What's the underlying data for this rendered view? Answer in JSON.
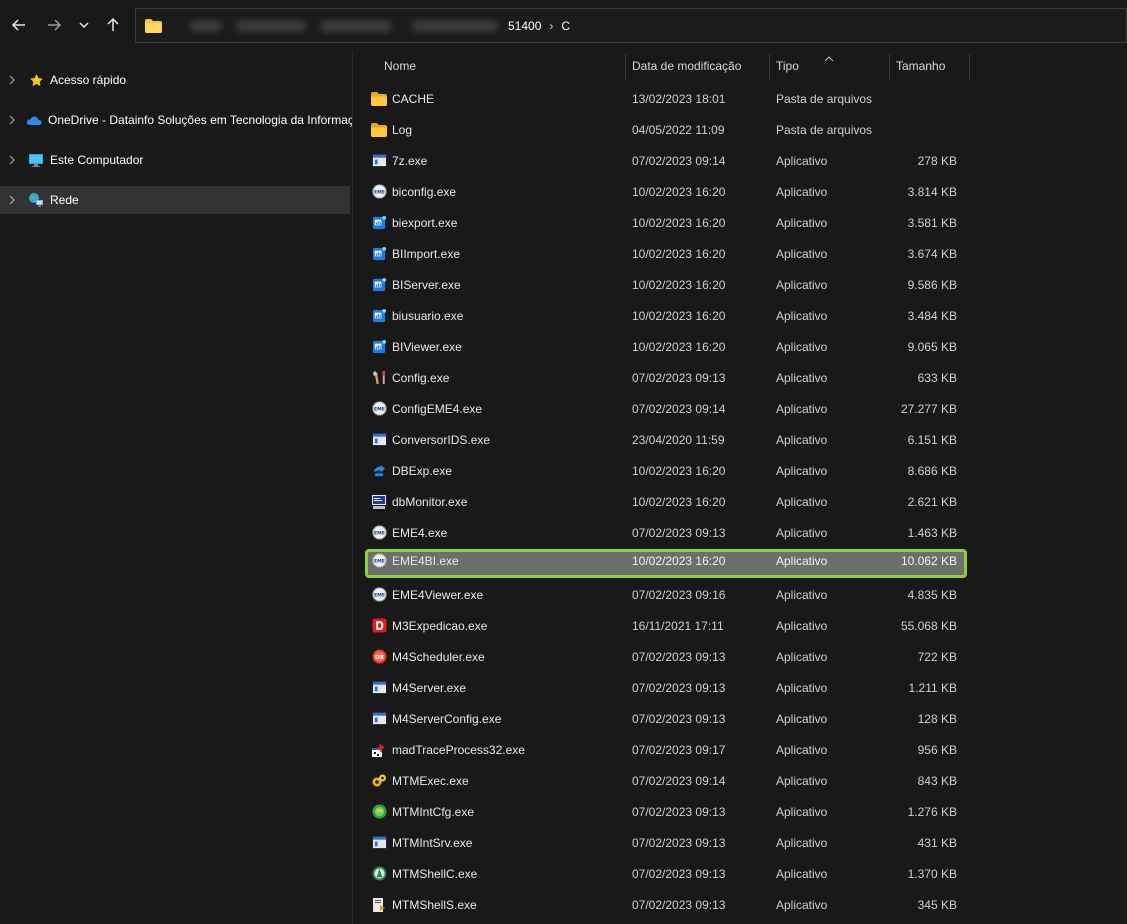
{
  "address": {
    "path_visible": [
      "51400",
      "C"
    ]
  },
  "sidebar": {
    "items": [
      {
        "label": "Acesso rápido",
        "icon": "star-icon"
      },
      {
        "label": "OneDrive - Datainfo Soluções em Tecnologia da Informação",
        "icon": "cloud-icon"
      },
      {
        "label": "Este Computador",
        "icon": "monitor-icon"
      },
      {
        "label": "Rede",
        "icon": "network-icon",
        "selected": true
      }
    ]
  },
  "columns": {
    "name": "Nome",
    "date": "Data de modificação",
    "type": "Tipo",
    "size": "Tamanho"
  },
  "files": [
    {
      "name": "CACHE",
      "date": "13/02/2023 18:01",
      "type": "Pasta de arquivos",
      "size": "",
      "icon": "folder-icon"
    },
    {
      "name": "Log",
      "date": "04/05/2022 11:09",
      "type": "Pasta de arquivos",
      "size": "",
      "icon": "folder-icon"
    },
    {
      "name": "7z.exe",
      "date": "07/02/2023 09:14",
      "type": "Aplicativo",
      "size": "278 KB",
      "icon": "window-app-icon"
    },
    {
      "name": "biconfig.exe",
      "date": "10/02/2023 16:20",
      "type": "Aplicativo",
      "size": "3.814 KB",
      "icon": "eme-icon"
    },
    {
      "name": "biexport.exe",
      "date": "10/02/2023 16:20",
      "type": "Aplicativo",
      "size": "3.581 KB",
      "icon": "bi-icon"
    },
    {
      "name": "BIImport.exe",
      "date": "10/02/2023 16:20",
      "type": "Aplicativo",
      "size": "3.674 KB",
      "icon": "bi-icon"
    },
    {
      "name": "BIServer.exe",
      "date": "10/02/2023 16:20",
      "type": "Aplicativo",
      "size": "9.586 KB",
      "icon": "bi-icon"
    },
    {
      "name": "biusuario.exe",
      "date": "10/02/2023 16:20",
      "type": "Aplicativo",
      "size": "3.484 KB",
      "icon": "bi-icon"
    },
    {
      "name": "BIViewer.exe",
      "date": "10/02/2023 16:20",
      "type": "Aplicativo",
      "size": "9.065 KB",
      "icon": "bi-icon"
    },
    {
      "name": "Config.exe",
      "date": "07/02/2023 09:13",
      "type": "Aplicativo",
      "size": "633 KB",
      "icon": "tools-icon"
    },
    {
      "name": "ConfigEME4.exe",
      "date": "07/02/2023 09:14",
      "type": "Aplicativo",
      "size": "27.277 KB",
      "icon": "eme-icon"
    },
    {
      "name": "ConversorIDS.exe",
      "date": "23/04/2020 11:59",
      "type": "Aplicativo",
      "size": "6.151 KB",
      "icon": "window-app-icon"
    },
    {
      "name": "DBExp.exe",
      "date": "10/02/2023 16:20",
      "type": "Aplicativo",
      "size": "8.686 KB",
      "icon": "dbexp-icon"
    },
    {
      "name": "dbMonitor.exe",
      "date": "10/02/2023 16:20",
      "type": "Aplicativo",
      "size": "2.621 KB",
      "icon": "monitor-app-icon"
    },
    {
      "name": "EME4.exe",
      "date": "07/02/2023 09:13",
      "type": "Aplicativo",
      "size": "1.463 KB",
      "icon": "eme-icon"
    },
    {
      "name": "EME4BI.exe",
      "date": "10/02/2023 16:20",
      "type": "Aplicativo",
      "size": "10.062 KB",
      "icon": "eme-icon",
      "selected": true
    },
    {
      "name": "EME4Viewer.exe",
      "date": "07/02/2023 09:16",
      "type": "Aplicativo",
      "size": "4.835 KB",
      "icon": "eme-icon"
    },
    {
      "name": "M3Expedicao.exe",
      "date": "16/11/2021 17:11",
      "type": "Aplicativo",
      "size": "55.068 KB",
      "icon": "red-d-icon"
    },
    {
      "name": "M4Scheduler.exe",
      "date": "07/02/2023 09:13",
      "type": "Aplicativo",
      "size": "722 KB",
      "icon": "dx-icon"
    },
    {
      "name": "M4Server.exe",
      "date": "07/02/2023 09:13",
      "type": "Aplicativo",
      "size": "1.211 KB",
      "icon": "window-app-icon"
    },
    {
      "name": "M4ServerConfig.exe",
      "date": "07/02/2023 09:13",
      "type": "Aplicativo",
      "size": "128 KB",
      "icon": "window-app-icon"
    },
    {
      "name": "madTraceProcess32.exe",
      "date": "07/02/2023 09:17",
      "type": "Aplicativo",
      "size": "956 KB",
      "icon": "mad-icon"
    },
    {
      "name": "MTMExec.exe",
      "date": "07/02/2023 09:14",
      "type": "Aplicativo",
      "size": "843 KB",
      "icon": "gear-app-icon"
    },
    {
      "name": "MTMIntCfg.exe",
      "date": "07/02/2023 09:13",
      "type": "Aplicativo",
      "size": "1.276 KB",
      "icon": "globe-green-icon"
    },
    {
      "name": "MTMIntSrv.exe",
      "date": "07/02/2023 09:13",
      "type": "Aplicativo",
      "size": "431 KB",
      "icon": "window-app-icon"
    },
    {
      "name": "MTMShellC.exe",
      "date": "07/02/2023 09:13",
      "type": "Aplicativo",
      "size": "1.370 KB",
      "icon": "shell-icon"
    },
    {
      "name": "MTMShellS.exe",
      "date": "07/02/2023 09:13",
      "type": "Aplicativo",
      "size": "345 KB",
      "icon": "shells-icon"
    }
  ],
  "colors": {
    "selection_outline": "#8dd13a",
    "selection_fill": "#6e6e6e",
    "folder": "#f4c542",
    "background": "#191919"
  }
}
